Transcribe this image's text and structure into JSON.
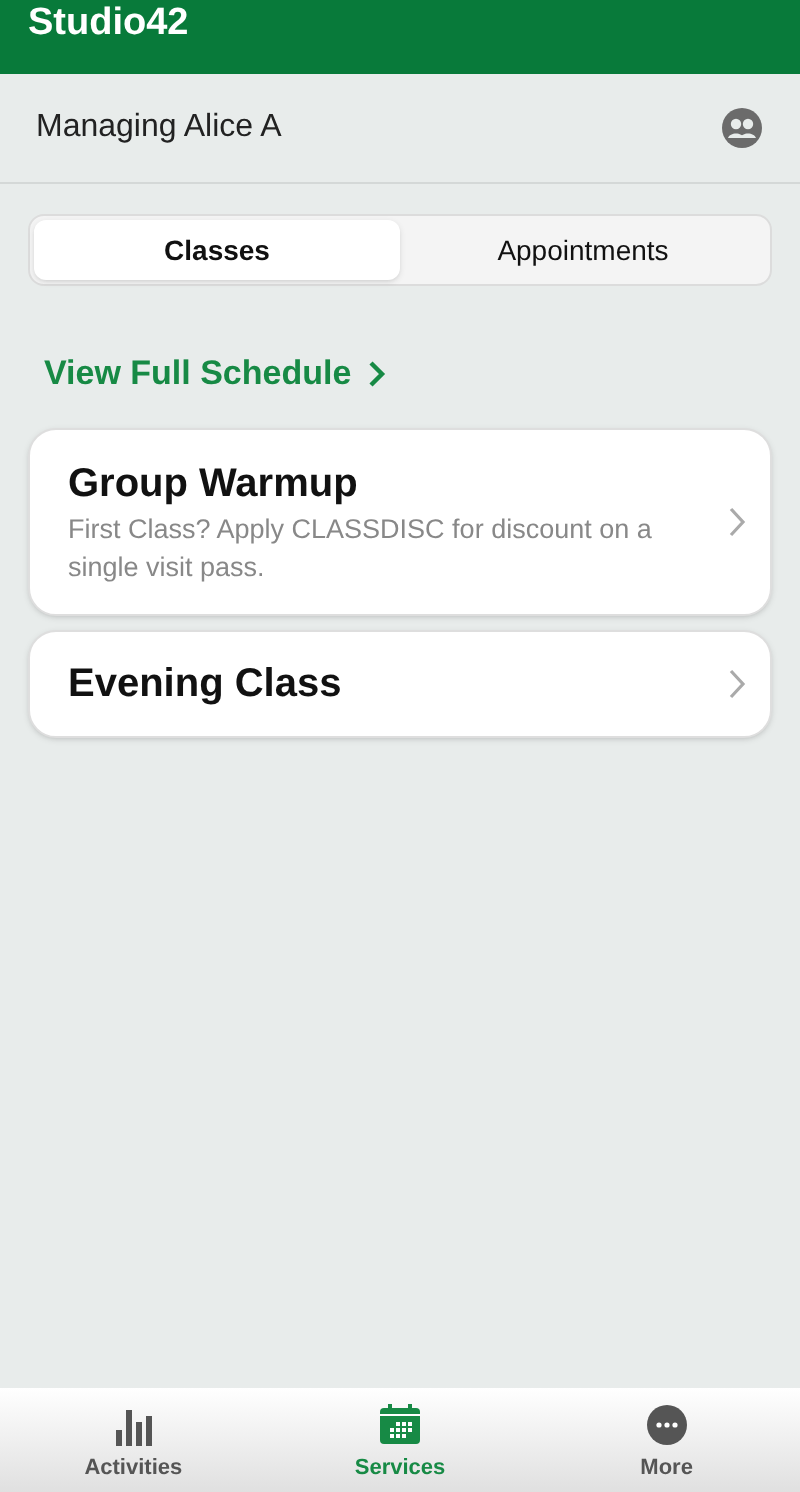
{
  "header": {
    "title": "Studio42"
  },
  "profile": {
    "label": "Managing Alice A"
  },
  "tabs": [
    {
      "label": "Classes",
      "selected": true
    },
    {
      "label": "Appointments",
      "selected": false
    }
  ],
  "schedule_link": {
    "label": "View Full Schedule"
  },
  "services": [
    {
      "title": "Group Warmup",
      "description": "First Class? Apply CLASSDISC for discount on a single visit pass."
    },
    {
      "title": "Evening Class"
    }
  ],
  "bottom_nav": [
    {
      "label": "Activities",
      "kind": "activities",
      "selected": false
    },
    {
      "label": "Services",
      "kind": "services",
      "selected": true
    },
    {
      "label": "More",
      "kind": "more",
      "selected": false
    }
  ]
}
